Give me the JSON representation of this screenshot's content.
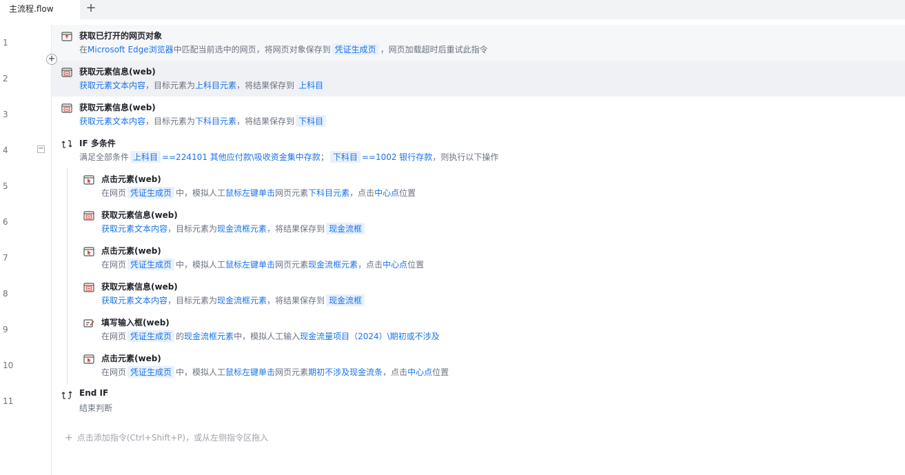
{
  "tab": {
    "title": "主流程.flow",
    "add_symbol": "+"
  },
  "line_numbers": [
    "1",
    "2",
    "3",
    "4",
    "5",
    "6",
    "7",
    "8",
    "9",
    "10",
    "11"
  ],
  "insert_symbol": "+",
  "collapse_symbol": "−",
  "rows": [
    {
      "title": "获取已打开的网页对象",
      "icon": "web-page-icon",
      "desc": [
        {
          "t": "在",
          "k": "txt"
        },
        {
          "t": "Microsoft Edge浏览器",
          "k": "lk"
        },
        {
          "t": "中匹配当前选中的网页，将网页对象保存到",
          "k": "txt"
        },
        {
          "t": "凭证生成页",
          "k": "chip"
        },
        {
          "t": "，网页加载超时后重试此指令",
          "k": "txt"
        }
      ]
    },
    {
      "title": "获取元素信息(web)",
      "icon": "web-element-info-icon",
      "desc": [
        {
          "t": "获取元素文本内容",
          "k": "lk"
        },
        {
          "t": "，目标元素为",
          "k": "txt"
        },
        {
          "t": "上科目元素",
          "k": "lk"
        },
        {
          "t": "，将结果保存到",
          "k": "txt"
        },
        {
          "t": "上科目",
          "k": "chip"
        }
      ]
    },
    {
      "title": "获取元素信息(web)",
      "icon": "web-element-info-icon",
      "desc": [
        {
          "t": "获取元素文本内容",
          "k": "lk"
        },
        {
          "t": "，目标元素为",
          "k": "txt"
        },
        {
          "t": "下科目元素",
          "k": "lk"
        },
        {
          "t": "，将结果保存到",
          "k": "txt"
        },
        {
          "t": "下科目",
          "k": "chip"
        }
      ]
    },
    {
      "title": "IF 多条件",
      "icon": "if-branch-icon",
      "desc": [
        {
          "t": "满足全部条件",
          "k": "txt"
        },
        {
          "t": "上科目",
          "k": "chip"
        },
        {
          "t": "==224101 其他应付款\\吸收资金集中存款",
          "k": "lk"
        },
        {
          "t": "；",
          "k": "txt"
        },
        {
          "t": "下科目",
          "k": "chip"
        },
        {
          "t": "==1002 银行存款",
          "k": "lk"
        },
        {
          "t": "，则执行以下操作",
          "k": "txt"
        }
      ]
    },
    {
      "title": "点击元素(web)",
      "icon": "web-click-icon",
      "desc": [
        {
          "t": "在网页",
          "k": "txt"
        },
        {
          "t": "凭证生成页",
          "k": "chip"
        },
        {
          "t": "中，模拟人工",
          "k": "txt"
        },
        {
          "t": "鼠标左键单击",
          "k": "lk"
        },
        {
          "t": "网页元素",
          "k": "txt"
        },
        {
          "t": "下科目元素",
          "k": "lk"
        },
        {
          "t": "，点击",
          "k": "txt"
        },
        {
          "t": "中心点",
          "k": "lk"
        },
        {
          "t": "位置",
          "k": "txt"
        }
      ]
    },
    {
      "title": "获取元素信息(web)",
      "icon": "web-element-info-icon",
      "desc": [
        {
          "t": "获取元素文本内容",
          "k": "lk"
        },
        {
          "t": "，目标元素为",
          "k": "txt"
        },
        {
          "t": "现金流框元素",
          "k": "lk"
        },
        {
          "t": "，将结果保存到",
          "k": "txt"
        },
        {
          "t": "现金流框",
          "k": "chip"
        }
      ]
    },
    {
      "title": "点击元素(web)",
      "icon": "web-click-icon",
      "desc": [
        {
          "t": "在网页",
          "k": "txt"
        },
        {
          "t": "凭证生成页",
          "k": "chip"
        },
        {
          "t": "中，模拟人工",
          "k": "txt"
        },
        {
          "t": "鼠标左键单击",
          "k": "lk"
        },
        {
          "t": "网页元素",
          "k": "txt"
        },
        {
          "t": "现金流框元素",
          "k": "lk"
        },
        {
          "t": "，点击",
          "k": "txt"
        },
        {
          "t": "中心点",
          "k": "lk"
        },
        {
          "t": "位置",
          "k": "txt"
        }
      ]
    },
    {
      "title": "获取元素信息(web)",
      "icon": "web-element-info-icon",
      "desc": [
        {
          "t": "获取元素文本内容",
          "k": "lk"
        },
        {
          "t": "，目标元素为",
          "k": "txt"
        },
        {
          "t": "现金流框元素",
          "k": "lk"
        },
        {
          "t": "，将结果保存到",
          "k": "txt"
        },
        {
          "t": "现金流框",
          "k": "chip"
        }
      ]
    },
    {
      "title": "填写输入框(web)",
      "icon": "fill-input-icon",
      "desc": [
        {
          "t": "在网页",
          "k": "txt"
        },
        {
          "t": "凭证生成页",
          "k": "chip"
        },
        {
          "t": "的",
          "k": "txt"
        },
        {
          "t": "现金流框元素",
          "k": "lk"
        },
        {
          "t": "中，模拟人工输入",
          "k": "txt"
        },
        {
          "t": "现金流量项目（2024）\\期初或不涉及",
          "k": "lk"
        }
      ]
    },
    {
      "title": "点击元素(web)",
      "icon": "web-click-icon",
      "desc": [
        {
          "t": "在网页",
          "k": "txt"
        },
        {
          "t": "凭证生成页",
          "k": "chip"
        },
        {
          "t": "中，模拟人工",
          "k": "txt"
        },
        {
          "t": "鼠标左键单击",
          "k": "lk"
        },
        {
          "t": "网页元素",
          "k": "txt"
        },
        {
          "t": "期初不涉及现金流条",
          "k": "lk"
        },
        {
          "t": "，点击",
          "k": "txt"
        },
        {
          "t": "中心点",
          "k": "lk"
        },
        {
          "t": "位置",
          "k": "txt"
        }
      ]
    },
    {
      "title": "End IF",
      "icon": "end-if-icon",
      "desc": [
        {
          "t": "结束判断",
          "k": "txt"
        }
      ]
    }
  ],
  "add_command": {
    "symbol": "+",
    "label": "点击添加指令(Ctrl+Shift+P)，或从左侧指令区拖入"
  }
}
